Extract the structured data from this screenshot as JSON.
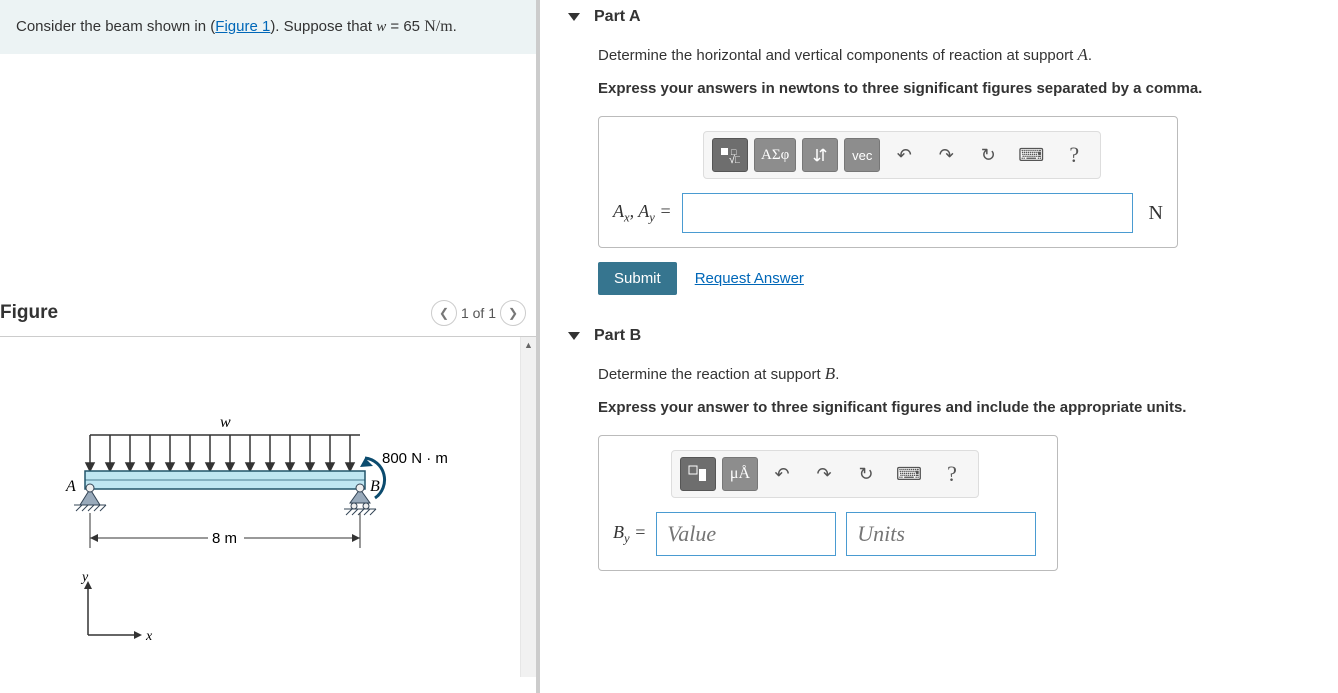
{
  "problem": {
    "prefix": "Consider the beam shown in (",
    "figure_link": "Figure 1",
    "suffix": "). Suppose that ",
    "var": "w",
    "eq": " = 65 ",
    "units": "N/m",
    "period": "."
  },
  "figure": {
    "title": "Figure",
    "pager": "1 of 1",
    "labels": {
      "w": "w",
      "moment": "800 N · m",
      "A": "A",
      "B": "B",
      "span": "8 m",
      "x": "x",
      "y": "y"
    }
  },
  "partA": {
    "title": "Part A",
    "instr_prefix": "Determine the horizontal and vertical components of reaction at support ",
    "instr_var": "A",
    "instr_suffix": ".",
    "bold": "Express your answers in newtons to three significant figures separated by a comma.",
    "label_html": "A_x, A_y =",
    "unit": "N",
    "submit": "Submit",
    "request": "Request Answer",
    "toolbar": {
      "greek": "ΑΣφ",
      "vec": "vec",
      "help": "?"
    }
  },
  "partB": {
    "title": "Part B",
    "instr_prefix": "Determine the reaction at support ",
    "instr_var": "B",
    "instr_suffix": ".",
    "bold": "Express your answer to three significant figures and include the appropriate units.",
    "label": "B_y =",
    "value_ph": "Value",
    "units_ph": "Units",
    "toolbar": {
      "mu": "μÅ",
      "help": "?"
    }
  }
}
